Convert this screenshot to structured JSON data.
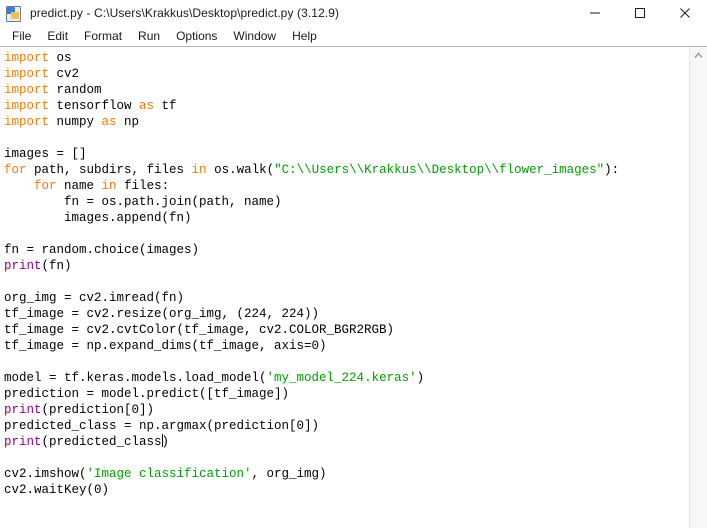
{
  "window": {
    "title": "predict.py - C:\\Users\\Krakkus\\Desktop\\predict.py (3.12.9)",
    "app_icon": "python-idle-icon",
    "controls": {
      "minimize": "minimize-icon",
      "maximize": "maximize-icon",
      "close": "close-icon"
    }
  },
  "menubar": {
    "items": [
      {
        "label": "File"
      },
      {
        "label": "Edit"
      },
      {
        "label": "Format"
      },
      {
        "label": "Run"
      },
      {
        "label": "Options"
      },
      {
        "label": "Window"
      },
      {
        "label": "Help"
      }
    ]
  },
  "editor": {
    "language": "python",
    "colors": {
      "keyword": "#ff7700",
      "string": "#00a000",
      "builtin": "#900090",
      "text": "#000000",
      "background": "#ffffff"
    },
    "cursor": {
      "line": 24,
      "after_text": "print(predicted_class"
    },
    "lines": [
      "import os",
      "import cv2",
      "import random",
      "import tensorflow as tf",
      "import numpy as np",
      "",
      "images = []",
      "for path, subdirs, files in os.walk(\"C:\\\\Users\\\\Krakkus\\\\Desktop\\\\flower_images\"):",
      "    for name in files:",
      "        fn = os.path.join(path, name)",
      "        images.append(fn)",
      "",
      "fn = random.choice(images)",
      "print(fn)",
      "",
      "org_img = cv2.imread(fn)",
      "tf_image = cv2.resize(org_img, (224, 224))",
      "tf_image = cv2.cvtColor(tf_image, cv2.COLOR_BGR2RGB)",
      "tf_image = np.expand_dims(tf_image, axis=0)",
      "",
      "model = tf.keras.models.load_model('my_model_224.keras')",
      "prediction = model.predict([tf_image])",
      "print(prediction[0])",
      "predicted_class = np.argmax(prediction[0])",
      "print(predicted_class)",
      "",
      "cv2.imshow('Image classification', org_img)",
      "cv2.waitKey(0)"
    ]
  },
  "scrollbar": {
    "up_arrow": "chevron-up-icon",
    "position": "top"
  }
}
